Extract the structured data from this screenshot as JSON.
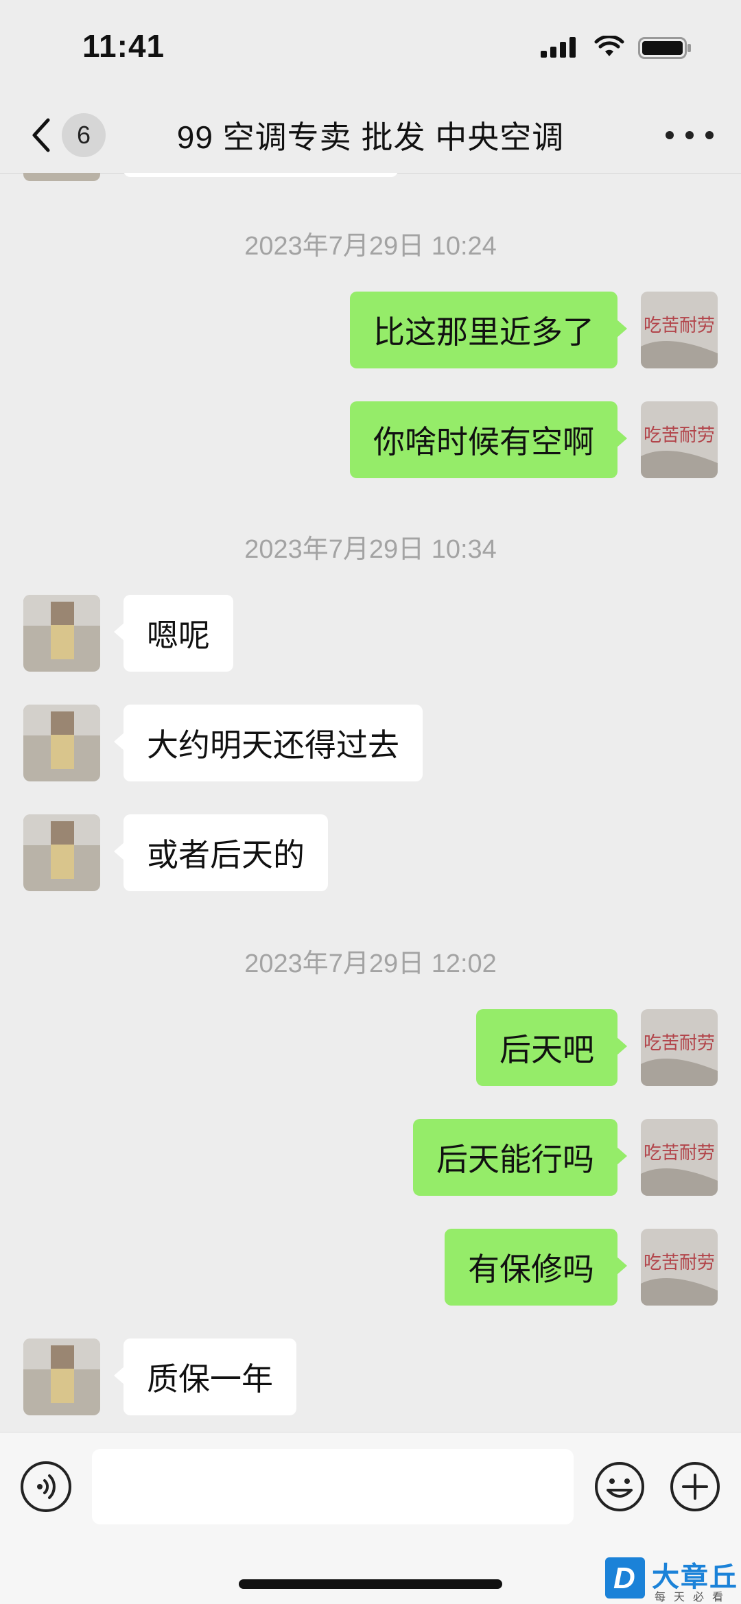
{
  "status_bar": {
    "time": "11:41"
  },
  "nav": {
    "unread_count": "6",
    "title": "99 空调专卖  批发 中央空调"
  },
  "messages": [
    {
      "type": "time",
      "text": "2023年7月29日 10:24"
    },
    {
      "type": "msg",
      "side": "self",
      "text": "比这那里近多了"
    },
    {
      "type": "msg",
      "side": "self",
      "text": "你啥时候有空啊"
    },
    {
      "type": "time",
      "text": "2023年7月29日 10:34"
    },
    {
      "type": "msg",
      "side": "other",
      "text": "嗯呢"
    },
    {
      "type": "msg",
      "side": "other",
      "text": "大约明天还得过去"
    },
    {
      "type": "msg",
      "side": "other",
      "text": "或者后天的"
    },
    {
      "type": "time",
      "text": "2023年7月29日 12:02"
    },
    {
      "type": "msg",
      "side": "self",
      "text": "后天吧"
    },
    {
      "type": "msg",
      "side": "self",
      "text": "后天能行吗"
    },
    {
      "type": "msg",
      "side": "self",
      "text": "有保修吗"
    },
    {
      "type": "msg",
      "side": "other",
      "text": "质保一年"
    }
  ],
  "input": {
    "value": "",
    "placeholder": ""
  },
  "watermark": {
    "text": "大章丘",
    "sub": "每天必看"
  },
  "colors": {
    "self_bubble": "#95ec69",
    "other_bubble": "#ffffff",
    "background": "#ededed"
  }
}
